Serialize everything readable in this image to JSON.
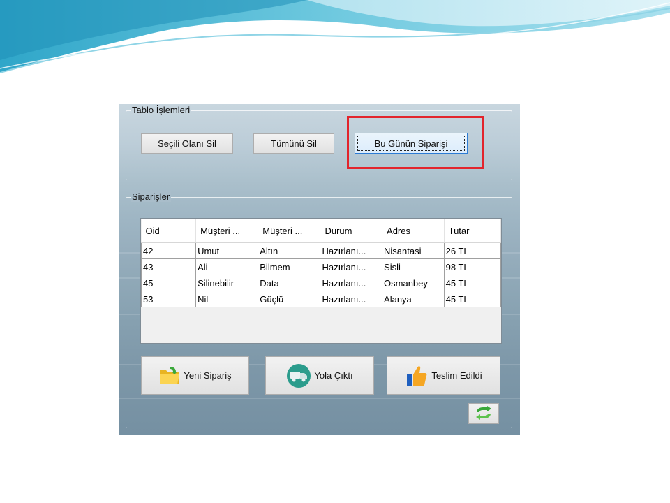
{
  "group_table_ops": {
    "label": "Tablo İşlemleri"
  },
  "toolbar": {
    "delete_selected": "Seçili Olanı Sil",
    "delete_all": "Tümünü Sil",
    "todays_order": "Bu Günün Siparişi"
  },
  "group_orders": {
    "label": "Siparişler"
  },
  "orders": {
    "columns": [
      "Oid",
      "Müşteri ...",
      "Müşteri ...",
      "Durum",
      "Adres",
      "Tutar"
    ],
    "rows": [
      [
        "42",
        "Umut",
        "Altın",
        "Hazırlanı...",
        "Nisantasi",
        "26 TL"
      ],
      [
        "43",
        "Ali",
        "Bilmem",
        "Hazırlanı...",
        "Sisli",
        "98 TL"
      ],
      [
        "45",
        "Silinebilir",
        "Data",
        "Hazırlanı...",
        "Osmanbey",
        "45 TL"
      ],
      [
        "53",
        "Nil",
        "Güçlü",
        "Hazırlanı...",
        "Alanya",
        "45 TL"
      ]
    ]
  },
  "actions": {
    "new_order": "Yeni Sipariş",
    "shipped": "Yola Çıktı",
    "delivered": "Teslim Edildi"
  },
  "icons": {
    "new_order": "folder-icon",
    "shipped": "delivery-truck-icon",
    "delivered": "thumbs-up-icon",
    "refresh": "refresh-icon"
  },
  "colors": {
    "highlight": "#e2242c",
    "banner_teal": "#4fb8d4",
    "focus_border": "#2d7bd3"
  }
}
